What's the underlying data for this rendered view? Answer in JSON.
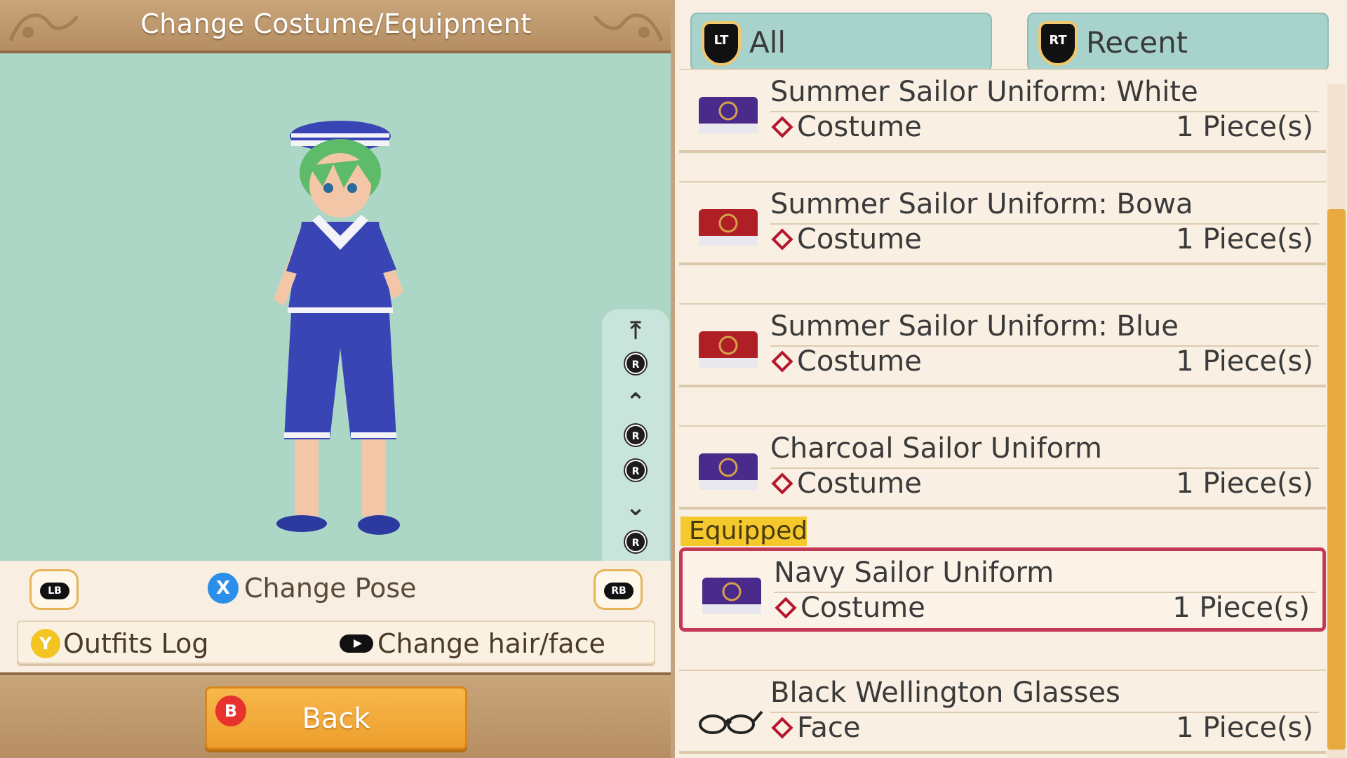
{
  "header": {
    "title": "Change Costume/Equipment"
  },
  "controls": {
    "lb": "LB",
    "rb": "RB",
    "pose_button": "X",
    "pose_label": "Change Pose",
    "log_button": "Y",
    "log_label": "Outfits Log",
    "hair_label": "Change hair/face",
    "stick_button": "R",
    "back_button": "B",
    "back_label": "Back"
  },
  "tabs": [
    {
      "trigger": "LT",
      "label": "All"
    },
    {
      "trigger": "RT",
      "label": "Recent"
    }
  ],
  "items": [
    {
      "name": "Summer Sailor Uniform: White",
      "category": "Costume",
      "qty": "1 Piece(s)",
      "icon": "purple-case-icon"
    },
    {
      "name": "Summer Sailor Uniform: Bowa",
      "category": "Costume",
      "qty": "1 Piece(s)",
      "icon": "red-case-icon"
    },
    {
      "name": "Summer Sailor Uniform: Blue",
      "category": "Costume",
      "qty": "1 Piece(s)",
      "icon": "red-case-icon"
    },
    {
      "name": "Charcoal Sailor Uniform",
      "category": "Costume",
      "qty": "1 Piece(s)",
      "icon": "purple-case-icon"
    },
    {
      "name": "Navy Sailor Uniform",
      "category": "Costume",
      "qty": "1 Piece(s)",
      "icon": "purple-case-icon",
      "equipped": true
    },
    {
      "name": "Black Wellington Glasses",
      "category": "Face",
      "qty": "1 Piece(s)",
      "icon": "glasses-icon"
    }
  ],
  "equipped_label": "Equipped",
  "colors": {
    "accent": "#e8a941",
    "preview_bg": "#acd6c6",
    "tab_bg": "#a8d3cd",
    "equipped_border": "#c23a55"
  }
}
